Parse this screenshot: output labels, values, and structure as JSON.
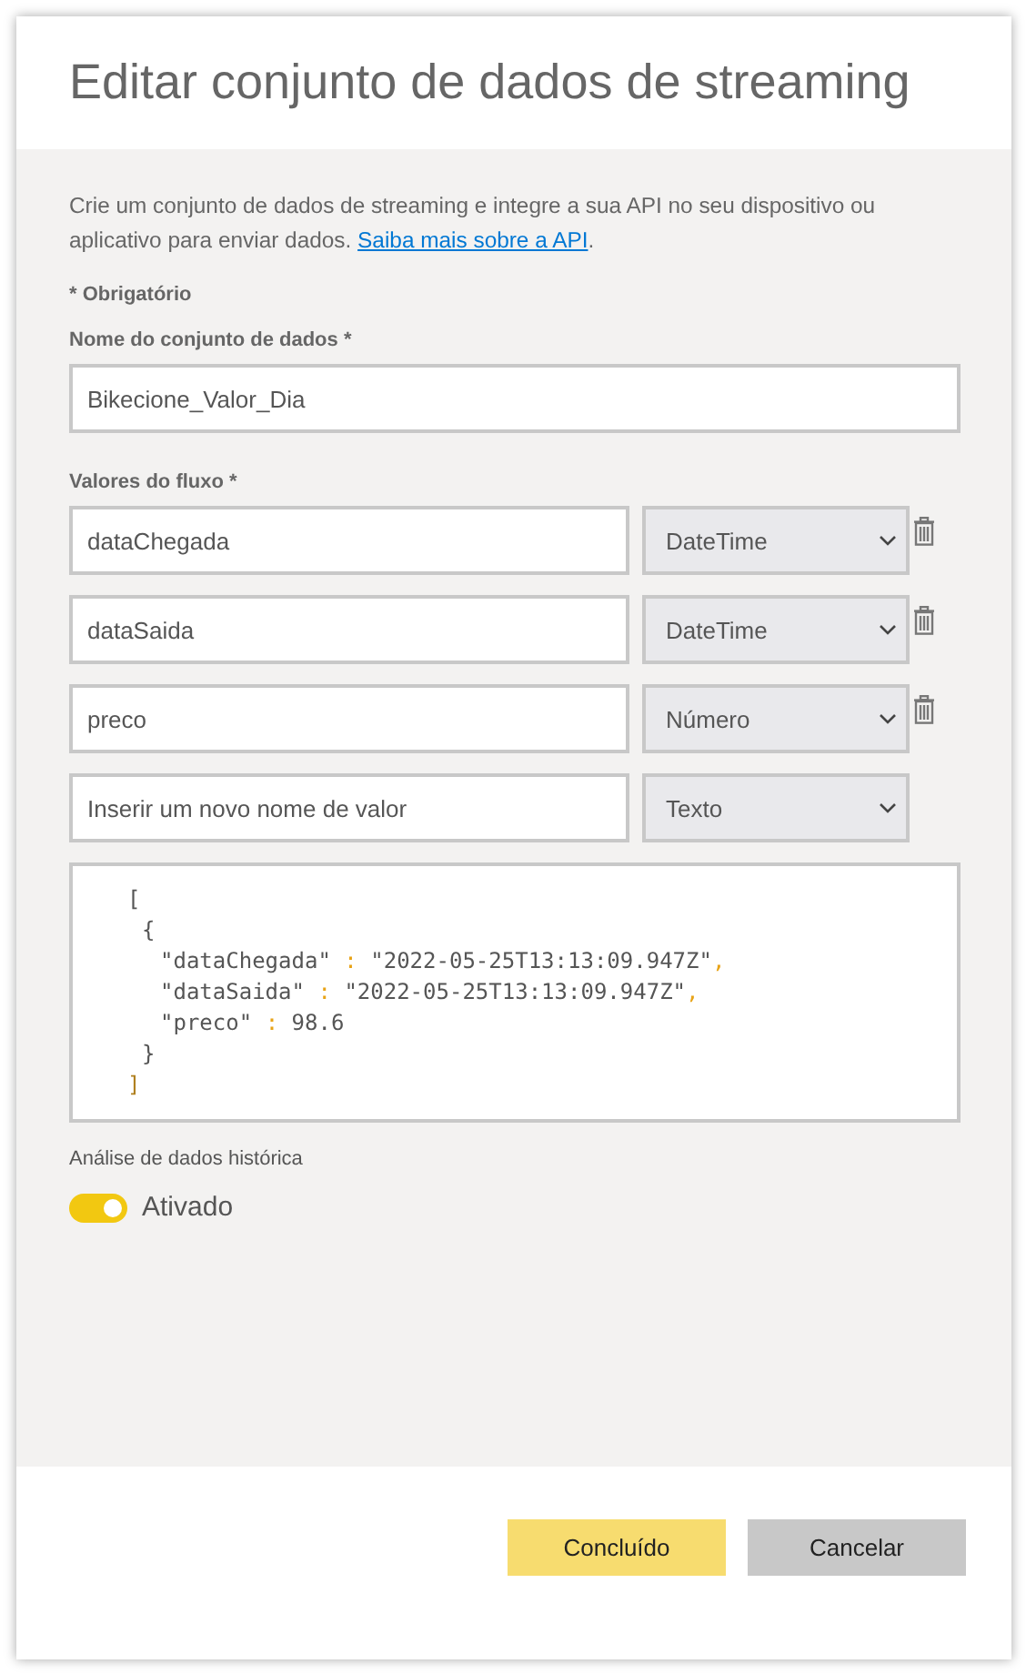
{
  "dialog": {
    "title": "Editar conjunto de dados de streaming",
    "intro": "Crie um conjunto de dados de streaming e integre a sua API no seu dispositivo ou aplicativo para enviar dados.",
    "intro_link": "Saiba mais sobre a API",
    "intro_end": ".",
    "required_note": "* Obrigatório",
    "name_label": "Nome do conjunto de dados",
    "name_required": "*",
    "name_value": "Bikecione_Valor_Dia",
    "values_label": "Valores do fluxo",
    "values_required": "*",
    "values": [
      {
        "name": "dataChegada",
        "type": "DateTime",
        "deletable": true
      },
      {
        "name": "dataSaida",
        "type": "DateTime",
        "deletable": true
      },
      {
        "name": "preco",
        "type": "Número",
        "deletable": true
      },
      {
        "placeholder": "Inserir um novo nome de valor",
        "type": "Texto",
        "deletable": false
      }
    ],
    "sample": {
      "open": "[",
      "items": [
        {
          "open": "{",
          "fields": [
            {
              "key": "\"dataChegada\"",
              "colon": ":",
              "value": "\"2022-05-25T13:13:09.947Z\"",
              "comma": ","
            },
            {
              "key": "\"dataSaida\"",
              "colon": ":",
              "value": "\"2022-05-25T13:13:09.947Z\"",
              "comma": ","
            },
            {
              "key": "\"preco\"",
              "colon": ":",
              "value": "98.6"
            }
          ],
          "close": "}"
        }
      ],
      "close": "]"
    },
    "history_label": "Análise de dados histórica",
    "history_on": true,
    "history_text": "Ativado",
    "buttons": [
      {
        "label": "Concluído",
        "kind": "primary"
      },
      {
        "label": "Cancelar",
        "kind": "secondary"
      }
    ]
  }
}
